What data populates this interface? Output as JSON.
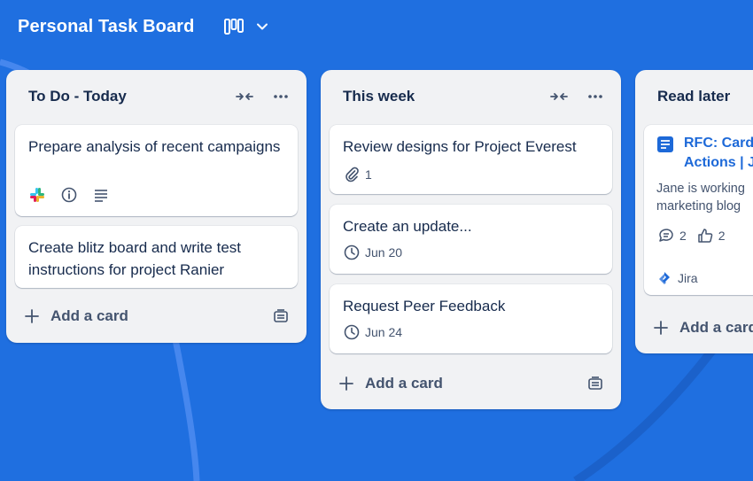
{
  "board": {
    "title": "Personal Task Board",
    "icons": {
      "view": "board-columns-icon",
      "dropdown": "chevron-down-icon"
    }
  },
  "colors": {
    "background": "#1f6fe0",
    "list_bg": "#f1f2f4",
    "link": "#1d69d8",
    "text": "#172b4d",
    "muted": "#44546f"
  },
  "lists": [
    {
      "title": "To Do - Today",
      "cards": [
        {
          "title": "Prepare analysis of recent campaigns",
          "badges": [
            "slack-icon",
            "info-icon",
            "description-icon"
          ]
        },
        {
          "title": "Create blitz board and write test instructions for project Ranier"
        }
      ],
      "add_card_label": "Add a card"
    },
    {
      "title": "This week",
      "cards": [
        {
          "title": "Review designs for Project Everest",
          "attachment_count": "1"
        },
        {
          "title": "Create an update...",
          "due": "Jun 20"
        },
        {
          "title": "Request Peer Feedback",
          "due": "Jun 24"
        }
      ],
      "add_card_label": "Add a card"
    },
    {
      "title": "Read later",
      "cards": [
        {
          "title": "RFC: Card Actions | J",
          "title_line1": "RFC: Card",
          "title_line2": "Actions | J",
          "description_line1": "Jane is working",
          "description_line2": "marketing blog",
          "comment_count": "2",
          "like_count": "2",
          "source": "Jira"
        }
      ],
      "add_card_label": "Add a card"
    }
  ]
}
